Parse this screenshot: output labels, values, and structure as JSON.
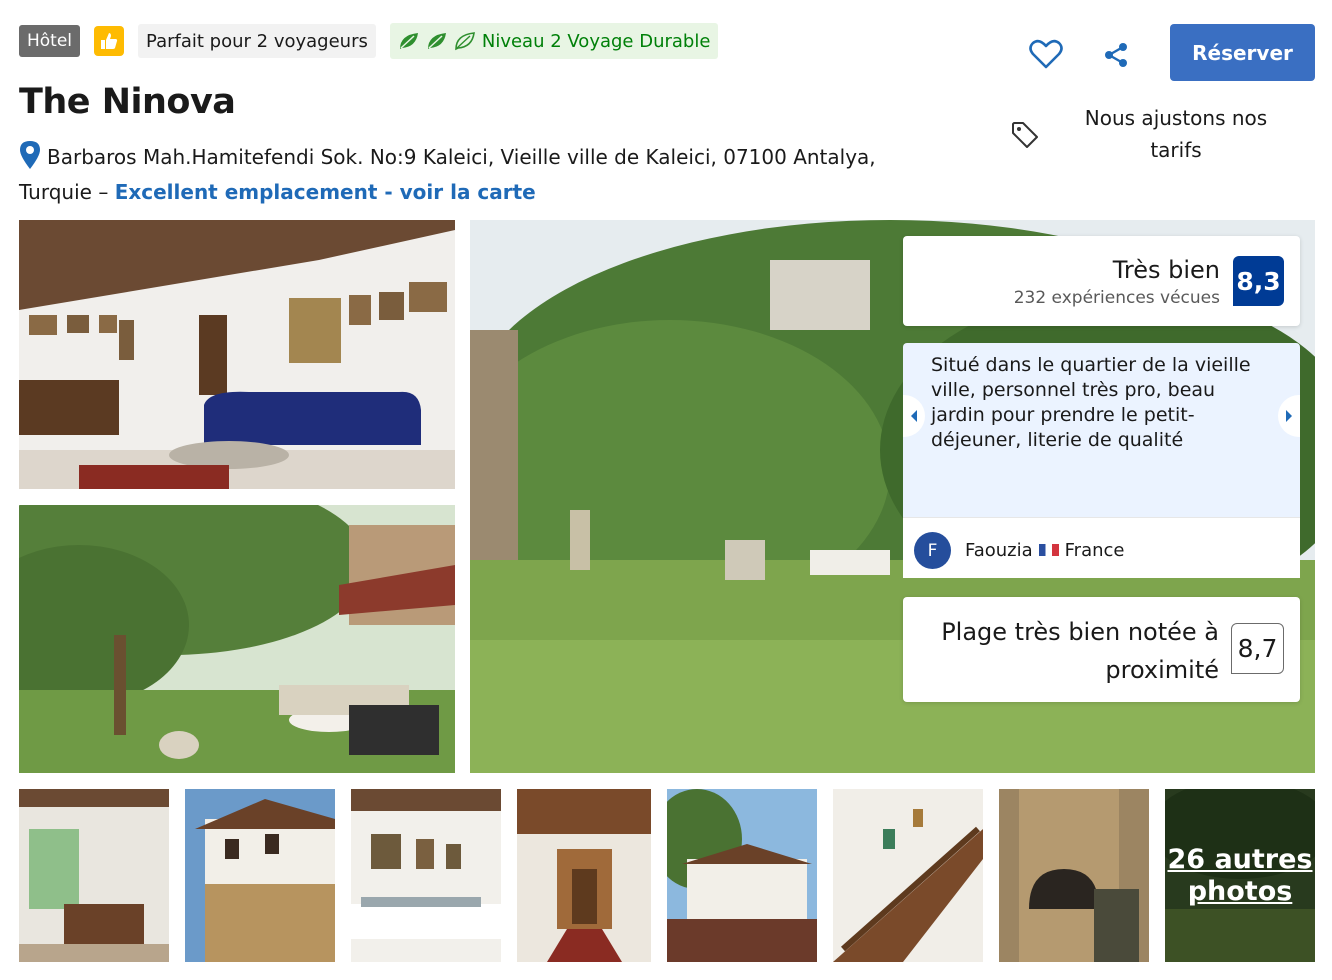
{
  "badges": {
    "type": "Hôtel",
    "thumb_icon": "thumbs-up-icon",
    "travelers": "Parfait pour 2 voyageurs",
    "eco_icon": "leaf-icon",
    "eco_level": "Niveau 2 Voyage Durable"
  },
  "actions": {
    "favorite_icon": "heart-icon",
    "share_icon": "share-icon",
    "reserve_label": "Réserver"
  },
  "hotel": {
    "name": "The Ninova",
    "address": "Barbaros Mah.Hamitefendi Sok. No:9 Kaleici, Vieille ville de Kaleici, 07100 Antalya, Turquie –",
    "location_link": "Excellent emplacement - voir la carte"
  },
  "price_note": "Nous ajustons nos tarifs",
  "rating": {
    "label": "Très bien",
    "reviews": "232 expériences vécues",
    "score": "8,3"
  },
  "review": {
    "text": "Situé dans le quartier de la vieille ville, personnel très pro, beau jardin pour prendre le petit-déjeuner, literie de qualité",
    "avatar_initial": "F",
    "reviewer_name": "Faouzia",
    "reviewer_country": "France"
  },
  "nearby": {
    "label": "Plage très bien notée à proximité",
    "score": "8,7"
  },
  "gallery": {
    "more_label": "26 autres photos"
  },
  "colors": {
    "primary": "#3a6fc2",
    "score_bg": "#003b95",
    "link": "#1f6ab7",
    "eco_green": "#008009"
  }
}
